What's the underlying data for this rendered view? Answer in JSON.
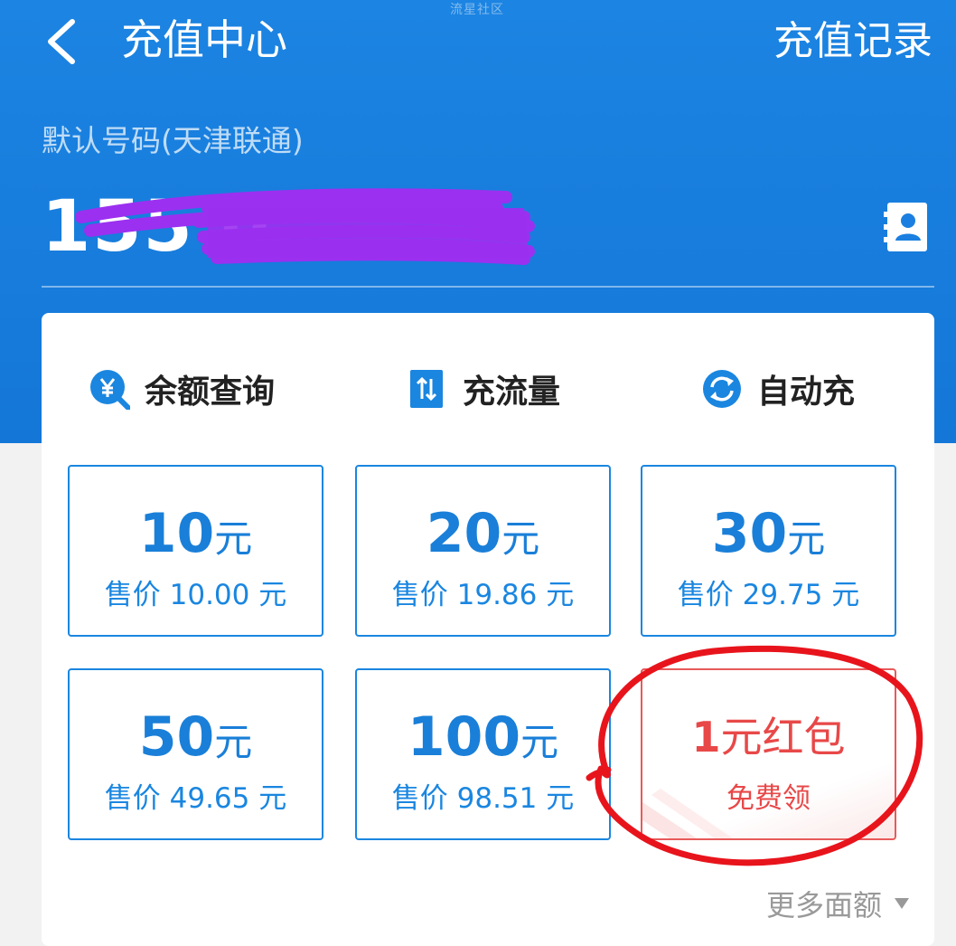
{
  "watermark": "流星社区",
  "header": {
    "title": "充值中心",
    "history_label": "充值记录",
    "carrier_label": "默认号码(天津联通)",
    "phone_number": "155 0"
  },
  "quick_actions": [
    {
      "label": "余额查询",
      "icon": "yuan-search-icon"
    },
    {
      "label": "充流量",
      "icon": "data-transfer-icon"
    },
    {
      "label": "自动充",
      "icon": "refresh-cycle-icon"
    }
  ],
  "tiles": [
    {
      "amount": "10",
      "unit": "元",
      "price": "售价 10.00 元"
    },
    {
      "amount": "20",
      "unit": "元",
      "price": "售价 19.86 元"
    },
    {
      "amount": "30",
      "unit": "元",
      "price": "售价 29.75 元"
    },
    {
      "amount": "50",
      "unit": "元",
      "price": "售价 49.65 元"
    },
    {
      "amount": "100",
      "unit": "元",
      "price": "售价 98.51 元"
    }
  ],
  "red_packet": {
    "amount": "1",
    "label": "元红包",
    "subtitle": "免费领"
  },
  "more_label": "更多面额",
  "colors": {
    "header_blue": "#1a7fe0",
    "tile_blue": "#1a86e0",
    "red": "#e84848",
    "annotation_red": "#e8141c",
    "redaction_purple": "#9b30f0"
  }
}
